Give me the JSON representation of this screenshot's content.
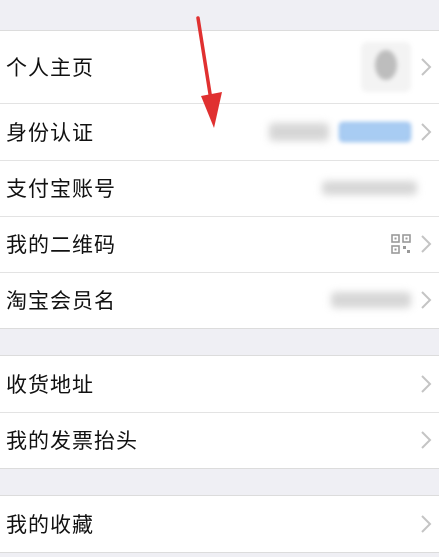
{
  "groups": [
    {
      "items": [
        {
          "label": "个人主页",
          "right": "avatar"
        },
        {
          "label": "身份认证",
          "right": "blurred-name-and-badge"
        },
        {
          "label": "支付宝账号",
          "right": "blurred-account"
        },
        {
          "label": "我的二维码",
          "right": "qr-icon"
        },
        {
          "label": "淘宝会员名",
          "right": "blurred-member"
        }
      ]
    },
    {
      "items": [
        {
          "label": "收货地址"
        },
        {
          "label": "我的发票抬头"
        }
      ]
    },
    {
      "items": [
        {
          "label": "我的收藏"
        }
      ]
    }
  ],
  "colors": {
    "background": "#efeff4",
    "row": "#ffffff",
    "text": "#111111",
    "chevron": "#c4c4c4",
    "annotation_arrow": "#e03030"
  },
  "icons": {
    "chevron": "chevron-right-icon",
    "qr": "qr-code-icon",
    "annotation": "red-arrow-annotation"
  }
}
